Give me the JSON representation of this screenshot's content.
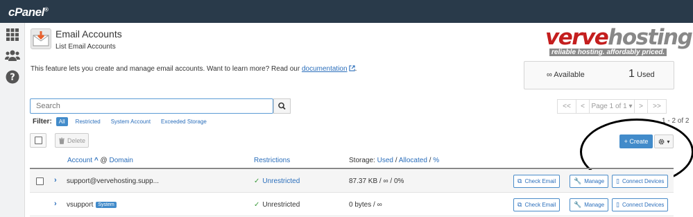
{
  "app": {
    "logo_text": "cPanel",
    "logo_reg": "®"
  },
  "page": {
    "title": "Email Accounts",
    "subtitle": "List Email Accounts"
  },
  "brand": {
    "name_part1": "verve",
    "name_part2": "hosting",
    "tagline": "reliable hosting. affordably priced."
  },
  "intro": {
    "text": "This feature lets you create and manage email accounts. Want to learn more? Read our ",
    "link": "documentation",
    "tail": "."
  },
  "stats": {
    "available_symbol": "∞",
    "available_label": "Available",
    "used_count": "1",
    "used_label": "Used"
  },
  "search": {
    "placeholder": "Search"
  },
  "pagination": {
    "first": "<<",
    "prev": "<",
    "page_label": "Page 1 of 1 ▾",
    "next": ">",
    "last": ">>",
    "count_text": "1 - 2 of 2"
  },
  "filter": {
    "label": "Filter:",
    "options": [
      {
        "label": "All",
        "active": true
      },
      {
        "label": "Restricted",
        "active": false
      },
      {
        "label": "System Account",
        "active": false
      },
      {
        "label": "Exceeded Storage",
        "active": false
      }
    ]
  },
  "toolbar": {
    "delete_label": "Delete",
    "create_label": "+ Create",
    "gear_caret": "▾"
  },
  "table": {
    "headers": {
      "account": "Account",
      "sort_arrow": "^",
      "at": "@",
      "domain": "Domain",
      "restrictions": "Restrictions",
      "storage_prefix": "Storage:",
      "used": "Used",
      "slash1": "/",
      "allocated": "Allocated",
      "slash2": "/",
      "percent": "%"
    },
    "rows": [
      {
        "account": "support@vervehosting.supp...",
        "badge": "",
        "restriction": "Unrestricted",
        "storage": "87.37 KB / ∞ / 0%",
        "actions": [
          "Check Email",
          "Manage",
          "Connect Devices"
        ]
      },
      {
        "account": "vsupport",
        "badge": "System",
        "restriction": "Unrestricted",
        "storage": "0 bytes / ∞",
        "actions": [
          "Check Email",
          "Manage",
          "Connect Devices"
        ]
      }
    ]
  },
  "colors": {
    "topbar": "#293a4a",
    "accent": "#428bca",
    "success": "#3c9b3c",
    "brand_red": "#c41e1e"
  }
}
